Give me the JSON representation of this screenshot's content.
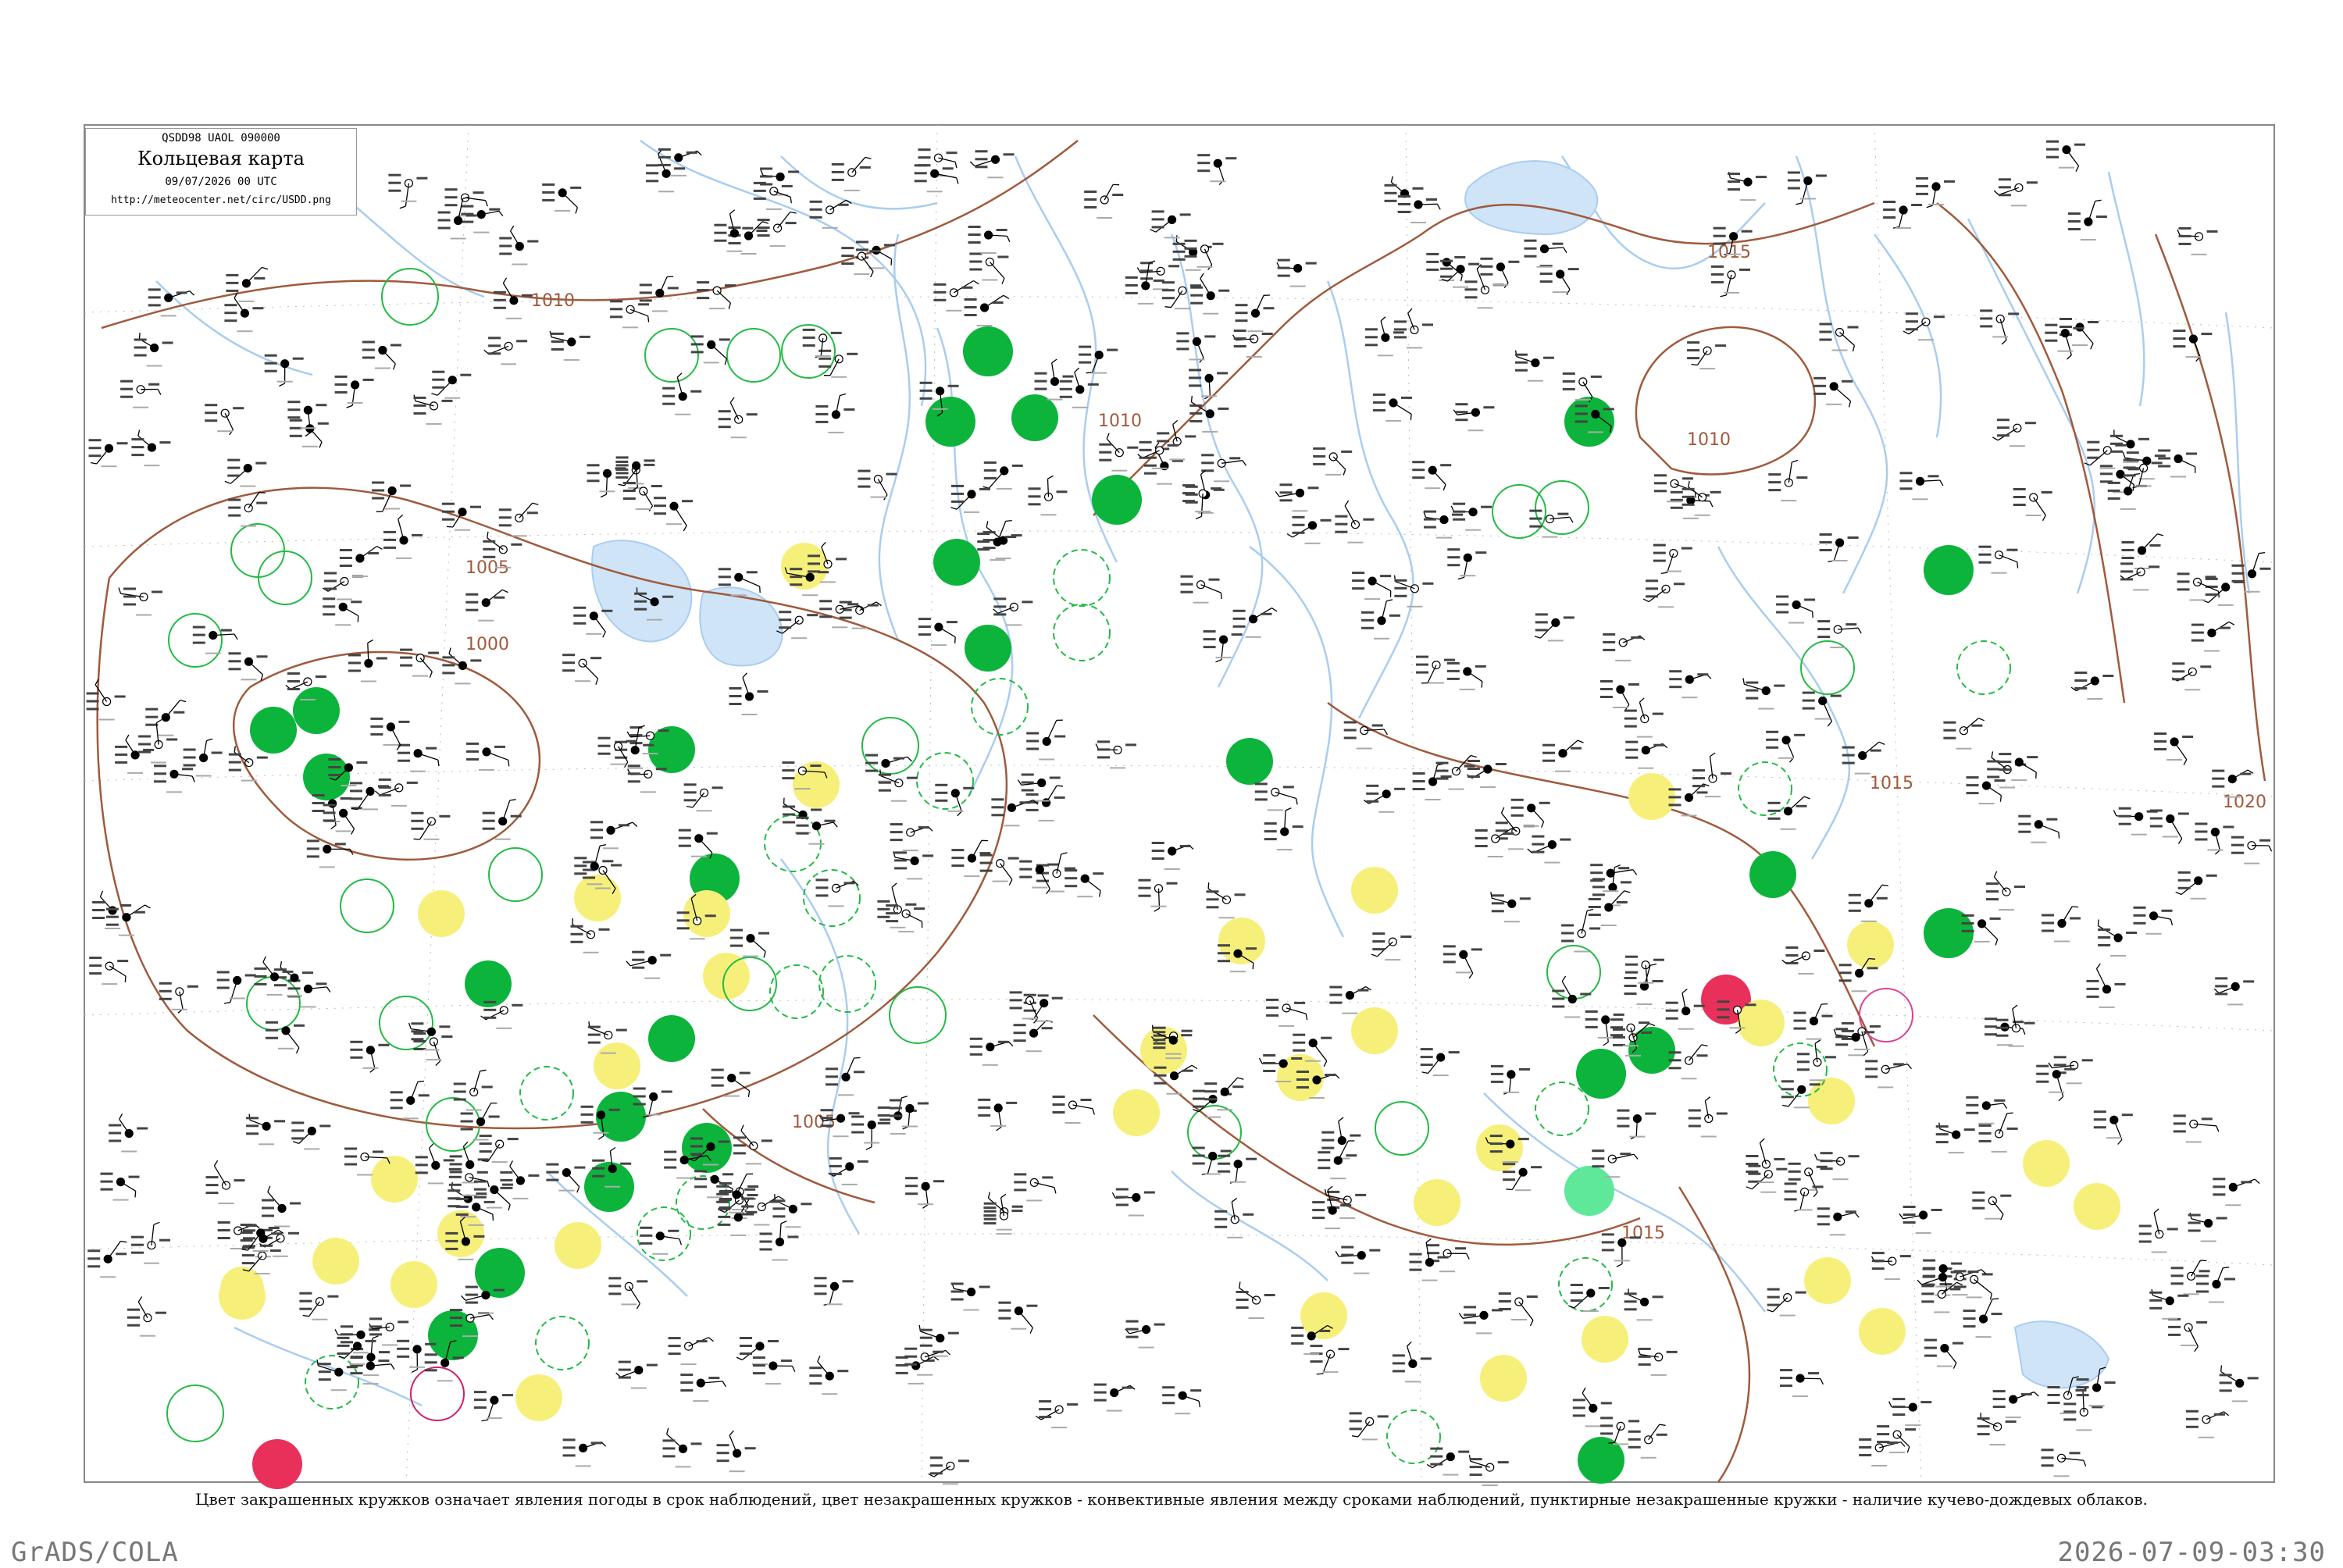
{
  "header": {
    "code": "QSDD98  UAOL  090000",
    "title": "Кольцевая карта",
    "date": "09/07/2026 00 UTC",
    "url": "http://meteocenter.net/circ/USDD.png"
  },
  "isobars": [
    {
      "label": "1010"
    },
    {
      "label": "1005"
    },
    {
      "label": "1000"
    },
    {
      "label": "1015"
    },
    {
      "label": "1020"
    }
  ],
  "colors": {
    "water": "#a9cdf0",
    "isobar": "#a05a3c",
    "station": "#000000",
    "station_id": "#909090",
    "green": "#0cb43c",
    "yellow": "#f6f07a",
    "red": "#e8305a",
    "light_green": "#5fe89a",
    "circle_outline": "#22bb44",
    "border": "#888888"
  },
  "legend": {
    "caption": "Цвет закрашенных кружков означает явления погоды в срок наблюдений, цвет незакрашенных кружков - конвективные явления между сроками наблюдений, пунктирные незакрашенные кружки - наличие кучево-дождевых облаков."
  },
  "footer": {
    "left": "GrADS/COLA",
    "right": "2026-07-09-03:30"
  }
}
